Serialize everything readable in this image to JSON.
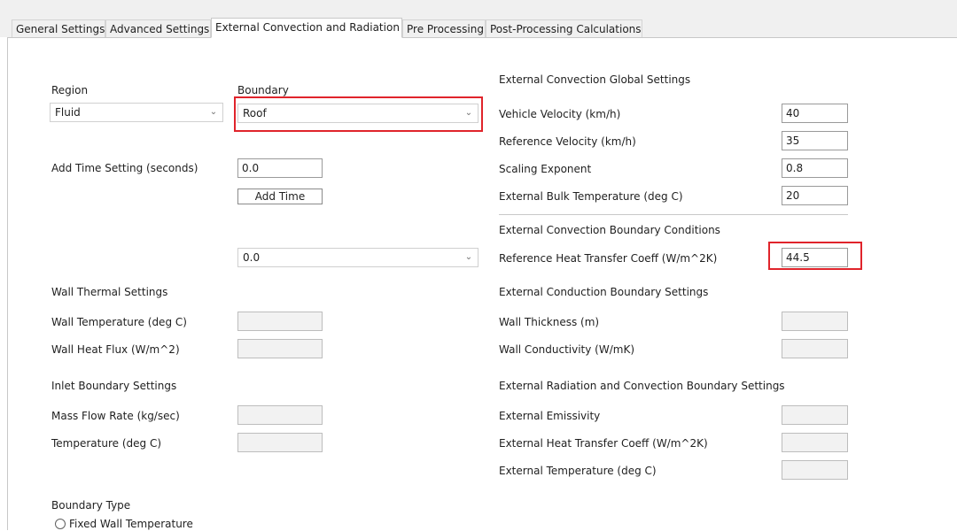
{
  "tabs": [
    {
      "label": "General Settings"
    },
    {
      "label": "Advanced Settings"
    },
    {
      "label": "External Convection and Radiation"
    },
    {
      "label": "Pre Processing"
    },
    {
      "label": "Post-Processing Calculations"
    }
  ],
  "left": {
    "region_label": "Region",
    "region_value": "Fluid",
    "boundary_label": "Boundary",
    "boundary_value": "Roof",
    "add_time_label": "Add Time Setting (seconds)",
    "add_time_value": "0.0",
    "add_time_button": "Add Time",
    "time_select_value": "0.0",
    "wall_thermal_heading": "Wall Thermal Settings",
    "wall_temp_label": "Wall Temperature (deg C)",
    "wall_heat_flux_label": "Wall Heat Flux (W/m^2)",
    "inlet_heading": "Inlet Boundary Settings",
    "mass_flow_label": "Mass Flow Rate (kg/sec)",
    "inlet_temp_label": "Temperature (deg C)",
    "boundary_type_heading": "Boundary Type",
    "fixed_wall_temp_label": "Fixed Wall Temperature"
  },
  "right": {
    "global_heading": "External Convection Global Settings",
    "vehicle_velocity_label": "Vehicle Velocity (km/h)",
    "vehicle_velocity_value": "40",
    "reference_velocity_label": "Reference Velocity (km/h)",
    "reference_velocity_value": "35",
    "scaling_exponent_label": "Scaling Exponent",
    "scaling_exponent_value": "0.8",
    "bulk_temp_label": "External Bulk Temperature (deg C)",
    "bulk_temp_value": "20",
    "conv_bc_heading": "External Convection Boundary Conditions",
    "ref_htc_label": "Reference Heat Transfer Coeff (W/m^2K)",
    "ref_htc_value": "44.5",
    "conduction_heading": "External Conduction Boundary Settings",
    "wall_thickness_label": "Wall Thickness (m)",
    "wall_conductivity_label": "Wall Conductivity (W/mK)",
    "radiation_heading": "External Radiation and Convection Boundary Settings",
    "emissivity_label": "External Emissivity",
    "ext_htc_label": "External Heat Transfer Coeff (W/m^2K)",
    "ext_temp_label": "External Temperature (deg C)"
  },
  "colors": {
    "highlight": "#e0242b",
    "tab_bar": "#f0f0f0",
    "disabled_field": "#f2f2f2"
  }
}
